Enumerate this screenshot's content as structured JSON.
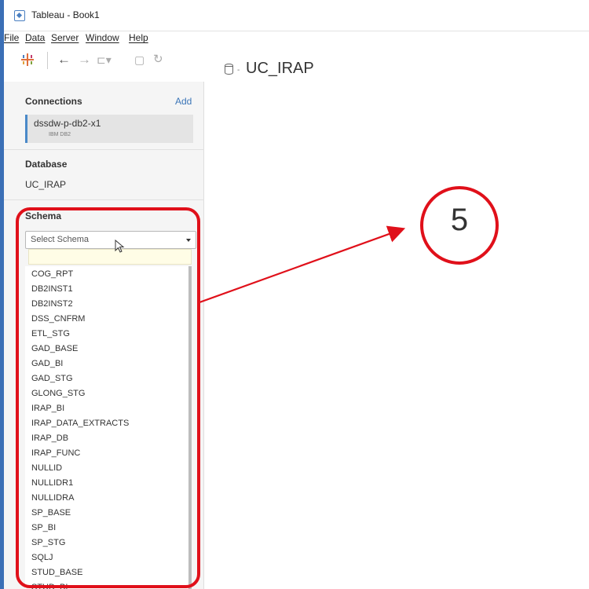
{
  "window": {
    "title": "Tableau - Book1"
  },
  "menu": {
    "items": [
      "File",
      "Data",
      "Server",
      "Window",
      "Help"
    ]
  },
  "toolbar": {
    "icons": [
      "tableau-logo-icon",
      "back-arrow-icon",
      "forward-arrow-icon",
      "paste-icon",
      "save-icon",
      "refresh-icon"
    ]
  },
  "sidebar": {
    "connections_title": "Connections",
    "add_label": "Add",
    "connection": {
      "name": "dssdw-p-db2-x1",
      "type": "IBM DB2"
    },
    "database_title": "Database",
    "database_value": "UC_IRAP",
    "schema_title": "Schema",
    "schema_select": "Select Schema",
    "schemas": [
      "COG_RPT",
      "DB2INST1",
      "DB2INST2",
      "DSS_CNFRM",
      "ETL_STG",
      "GAD_BASE",
      "GAD_BI",
      "GAD_STG",
      "GLONG_STG",
      "IRAP_BI",
      "IRAP_DATA_EXTRACTS",
      "IRAP_DB",
      "IRAP_FUNC",
      "NULLID",
      "NULLIDR1",
      "NULLIDRA",
      "SP_BASE",
      "SP_BI",
      "SP_STG",
      "SQLJ",
      "STUD_BASE",
      "STUD_BI"
    ]
  },
  "main": {
    "title": "UC_IRAP"
  },
  "annotation": {
    "number": "5",
    "color": "#e0101a"
  },
  "colors": {
    "accent": "#3b6fb6",
    "link": "#3c76b8"
  }
}
